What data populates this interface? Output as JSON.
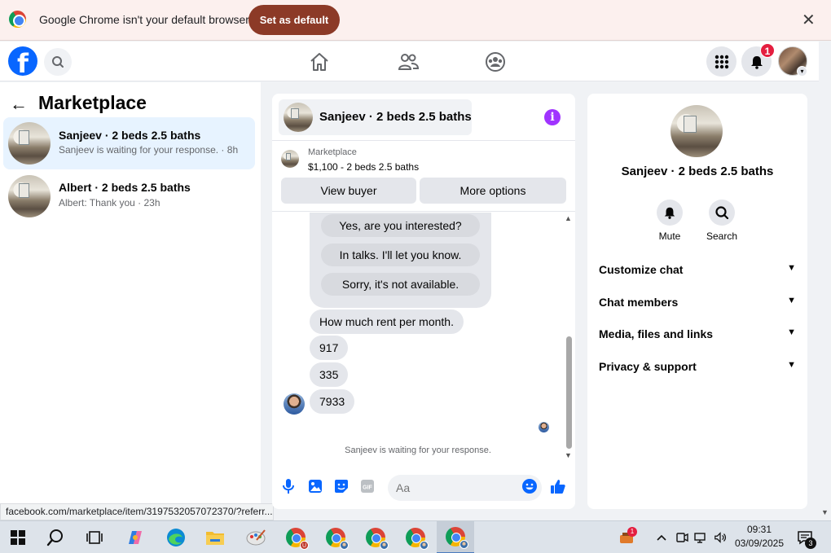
{
  "infobar": {
    "message": "Google Chrome isn't your default browser",
    "set_default_label": "Set as default",
    "close_glyph": "✕"
  },
  "topbar": {
    "logo_letter": "f",
    "notification_count": "1"
  },
  "left_panel": {
    "title": "Marketplace",
    "back_glyph": "←",
    "conversations": [
      {
        "name": "Sanjeev · 2 beds 2.5 baths",
        "preview": "Sanjeev is waiting for your response. · 8h",
        "active": true
      },
      {
        "name": "Albert · 2 beds 2.5 baths",
        "preview": "Albert: Thank you · 23h",
        "active": false
      }
    ]
  },
  "status_url": "facebook.com/marketplace/item/3197532057072370/?referr...",
  "chat": {
    "header_name": "Sanjeev · 2 beds 2.5 baths",
    "info_glyph": "i",
    "marketplace_label": "Marketplace",
    "listing_price": "$1,100 - 2 beds 2.5 baths",
    "view_buyer_label": "View buyer",
    "more_options_label": "More options",
    "quick_replies": [
      "Yes, are you interested?",
      "In talks. I'll let you know.",
      "Sorry, it's not available."
    ],
    "messages": [
      "How much rent per month.",
      "917",
      "335",
      "7933"
    ],
    "waiting_text": "Sanjeev is waiting for your response.",
    "composer_placeholder": "Aa"
  },
  "right_panel": {
    "name": "Sanjeev · 2 beds 2.5 baths",
    "actions": [
      {
        "label": "Mute",
        "icon": "bell-icon"
      },
      {
        "label": "Search",
        "icon": "search-icon"
      }
    ],
    "sections": [
      "Customize chat",
      "Chat members",
      "Media, files and links",
      "Privacy & support"
    ]
  },
  "taskbar": {
    "time": "09:31",
    "date": "03/09/2025",
    "notification_count": "3",
    "tray_badge": "1"
  },
  "colors": {
    "fb_blue": "#0866ff",
    "active_conversation": "#e7f3ff",
    "set_default_button": "#8c3a27",
    "info_purple": "#a033ff"
  }
}
